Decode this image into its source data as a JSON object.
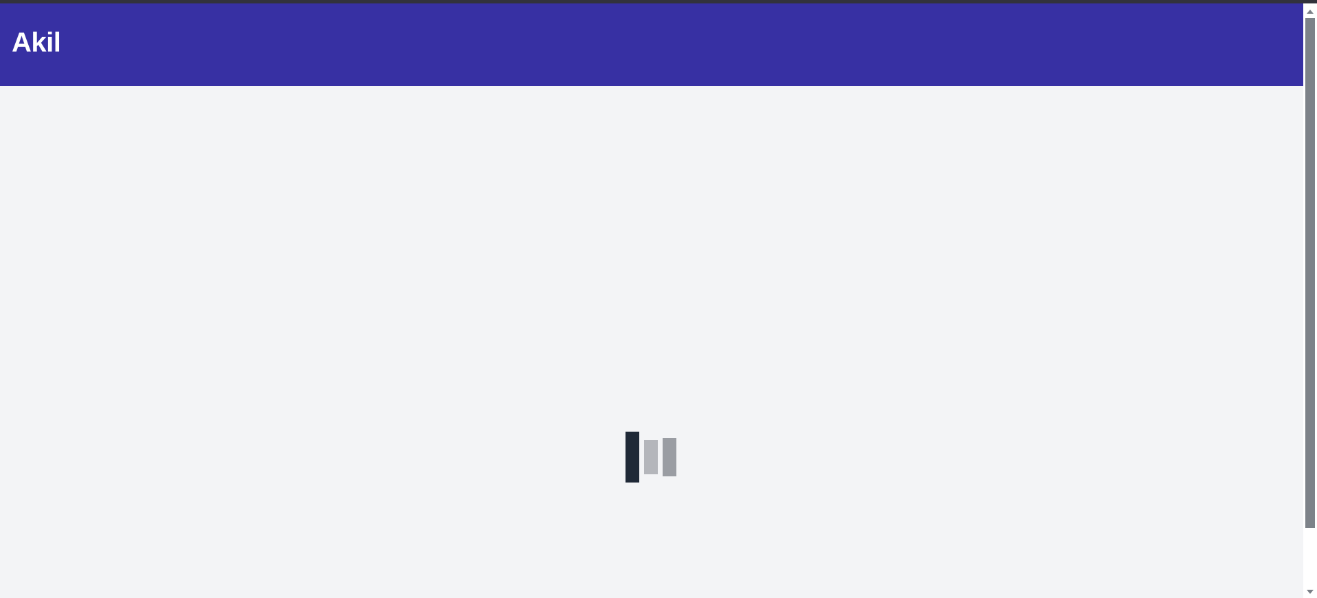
{
  "app": {
    "brand": "Akil"
  },
  "colors": {
    "header_bg": "#3730a3",
    "page_bg": "#f3f4f6",
    "loader_dark": "#1f2937",
    "loader_light": "#b4b6bb",
    "loader_mid": "#9a9da3"
  },
  "loader": {
    "icon": "loading-bars-icon",
    "bars": 3
  },
  "scrollbar": {
    "up_icon": "scroll-up-arrow-icon",
    "down_icon": "scroll-down-arrow-icon"
  }
}
